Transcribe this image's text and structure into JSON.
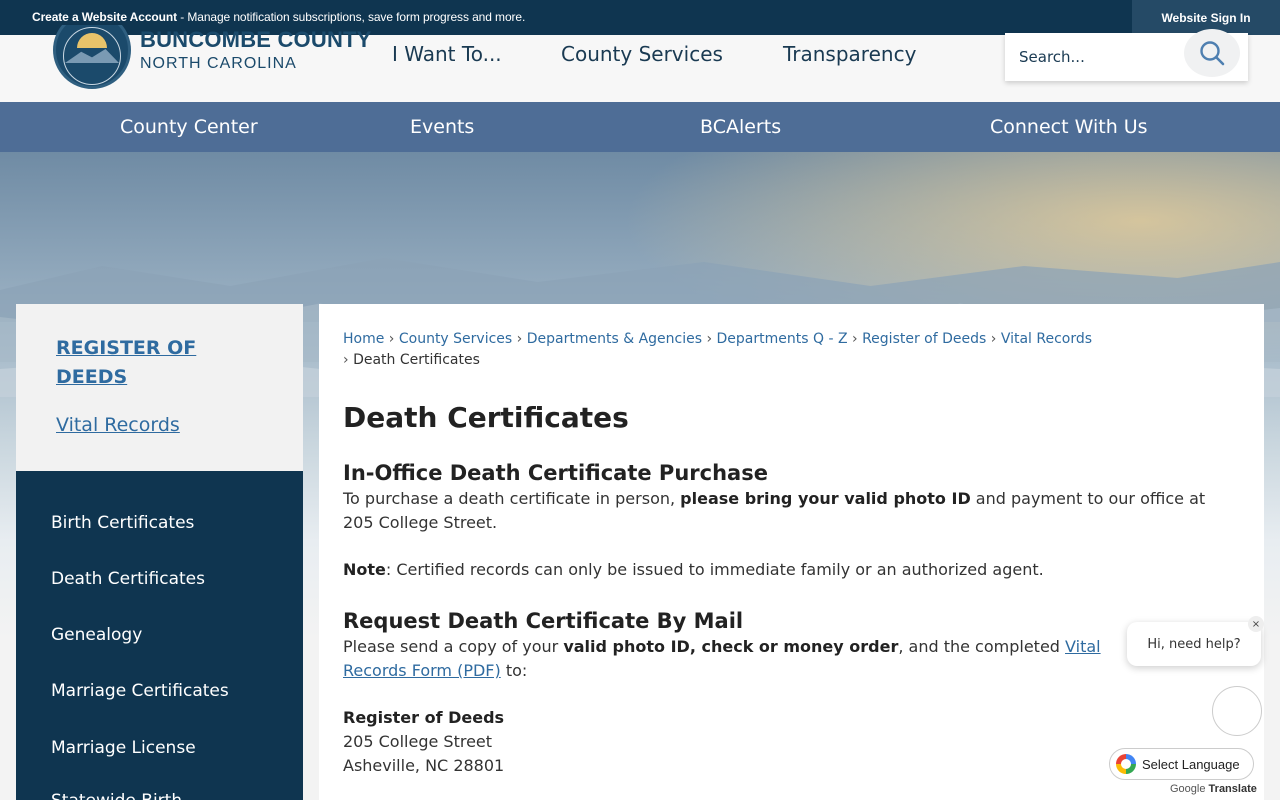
{
  "topbar": {
    "create_account": "Create a Website Account",
    "create_account_desc": " - Manage notification subscriptions, save form progress and more.",
    "sign_in": "Website Sign In"
  },
  "header": {
    "logo_title": "BUNCOMBE COUNTY",
    "logo_subtitle": "NORTH CAROLINA",
    "nav": [
      "I Want To...",
      "County Services",
      "Transparency"
    ],
    "search_placeholder": "Search..."
  },
  "navbar": {
    "items": [
      "County Center",
      "Events",
      "BCAlerts",
      "Connect With Us"
    ]
  },
  "sidebar": {
    "title": "REGISTER OF DEEDS",
    "subtitle": "Vital Records",
    "menu": [
      "Birth Certificates",
      "Death Certificates",
      "Genealogy",
      "Marriage Certificates",
      "Marriage License",
      "Statewide Birth"
    ]
  },
  "breadcrumbs": {
    "items": [
      "Home",
      "County Services",
      "Departments & Agencies",
      "Departments Q - Z",
      "Register of Deeds",
      "Vital Records"
    ],
    "current": "Death Certificates"
  },
  "content": {
    "title": "Death Certificates",
    "section1_heading": "In-Office Death Certificate Purchase",
    "section1_text_a": "To purchase a death certificate in person, ",
    "section1_text_b": "please bring your valid photo ID",
    "section1_text_c": " and payment to our office at 205 College Street.",
    "note_label": "Note",
    "note_text": ": Certified records can only be issued to immediate family or an authorized agent.",
    "section2_heading": "Request Death Certificate By Mail",
    "section2_text_a": "Please send a copy of your ",
    "section2_text_b": "valid photo ID, check or money order",
    "section2_text_c": ", and the completed ",
    "section2_link": "Vital Records Form (PDF)",
    "section2_text_d": " to:",
    "address_name": "Register of Deeds",
    "address_street": "205 College Street",
    "address_city": "Asheville, NC 28801"
  },
  "widgets": {
    "chat_prompt": "Hi, need help?",
    "chat_close": "×",
    "translate_label": "Select Language",
    "powered_by_google": "Google",
    "powered_by_translate": "Translate"
  },
  "colors": {
    "dark_blue": "#0f3550",
    "nav_blue": "#4e6d96",
    "link": "#2f6ba0"
  }
}
